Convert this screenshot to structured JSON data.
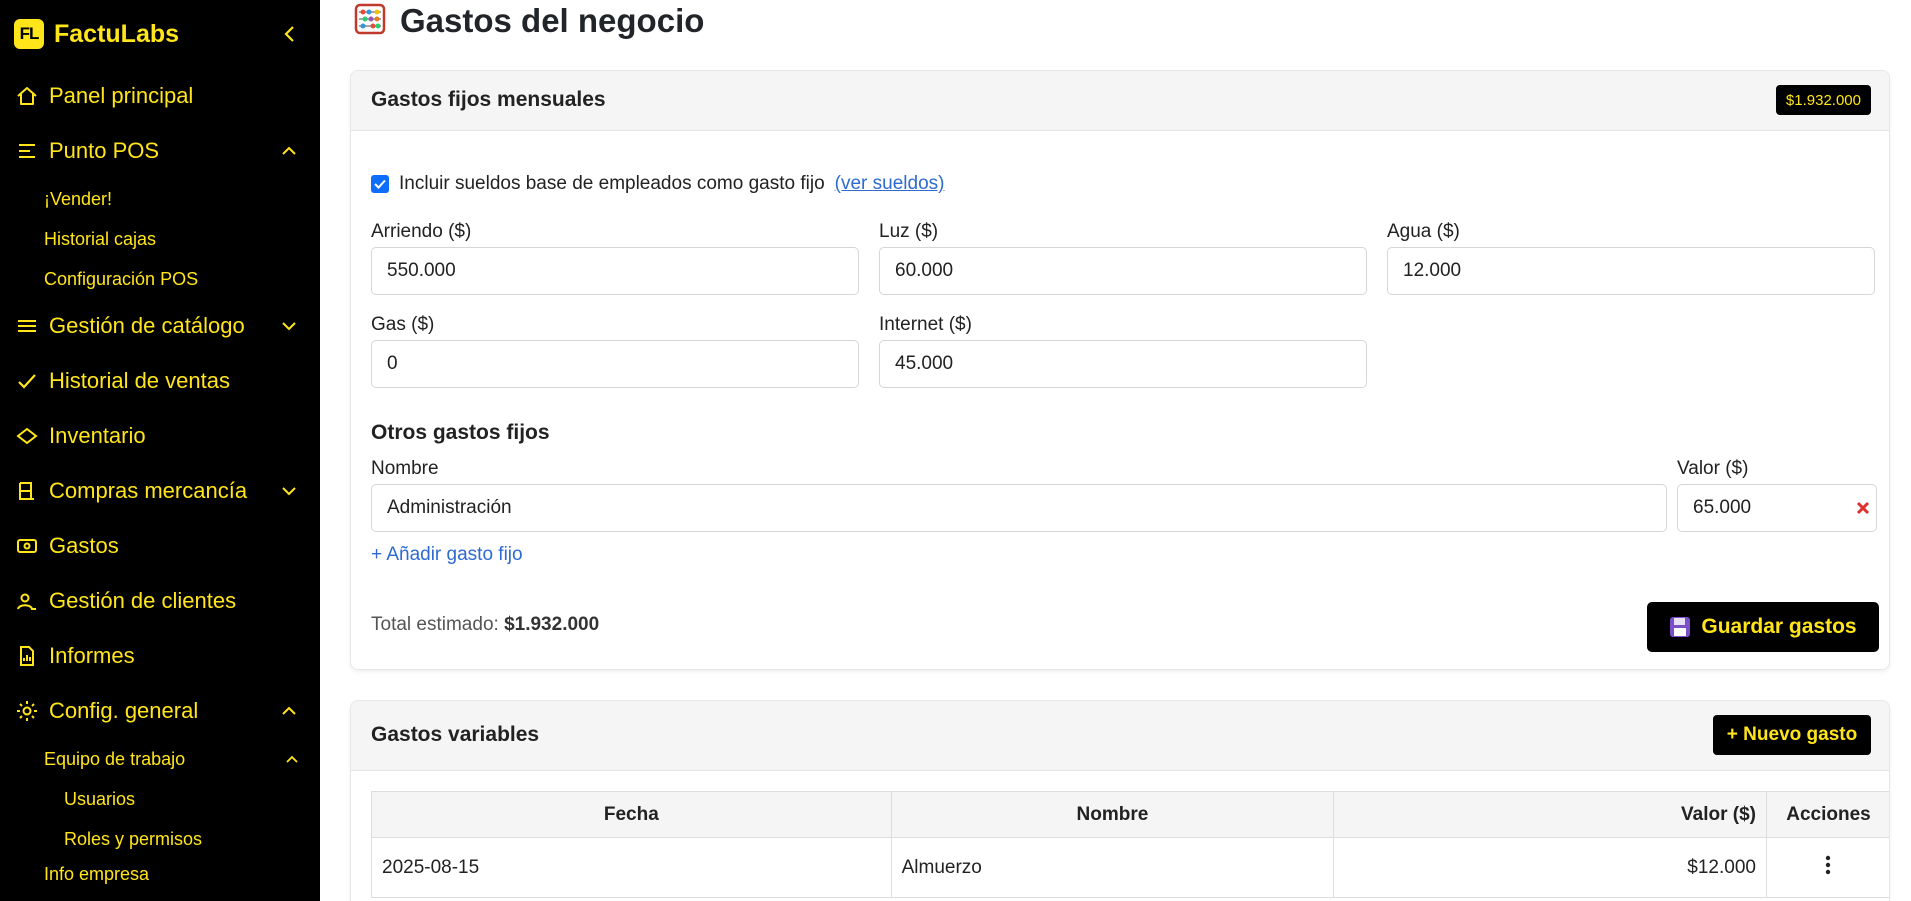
{
  "colors": {
    "accent": "#ffe51a",
    "sidebar_bg": "#000000",
    "link": "#2e6bd1",
    "checkbox": "#0d6efd",
    "remove": "#e03131"
  },
  "brand": {
    "logo_text": "FL",
    "name": "FactuLabs"
  },
  "sidebar": {
    "items": [
      {
        "label": "Panel principal",
        "icon": "home-icon"
      },
      {
        "label": "Punto POS",
        "icon": "pos-icon",
        "expanded": true
      },
      {
        "label": "Gestión de catálogo",
        "icon": "menu-icon",
        "expanded": false
      },
      {
        "label": "Historial de ventas",
        "icon": "check-icon"
      },
      {
        "label": "Inventario",
        "icon": "diamond-icon"
      },
      {
        "label": "Compras mercancía",
        "icon": "cart-icon",
        "expanded": false
      },
      {
        "label": "Gastos",
        "icon": "cash-icon"
      },
      {
        "label": "Gestión de clientes",
        "icon": "clients-icon"
      },
      {
        "label": "Informes",
        "icon": "report-icon"
      },
      {
        "label": "Config. general",
        "icon": "settings-icon",
        "expanded": true
      }
    ],
    "pos_sub": [
      "¡Vender!",
      "Historial cajas",
      "Configuración POS"
    ],
    "config_sub": {
      "team": "Equipo de trabajo",
      "team_sub": [
        "Usuarios",
        "Roles y permisos"
      ],
      "company": "Info empresa"
    }
  },
  "page": {
    "title": "Gastos del negocio",
    "icon": "abacus-icon"
  },
  "fixed": {
    "title": "Gastos fijos mensuales",
    "badge": "$1.932.000",
    "include_salaries": true,
    "include_label": "Incluir sueldos base de empleados como gasto fijo",
    "see_salaries": "(ver sueldos)",
    "fields": {
      "rent": {
        "label": "Arriendo ($)",
        "value": "550.000"
      },
      "power": {
        "label": "Luz ($)",
        "value": "60.000"
      },
      "water": {
        "label": "Agua ($)",
        "value": "12.000"
      },
      "gas": {
        "label": "Gas ($)",
        "value": "0"
      },
      "internet": {
        "label": "Internet ($)",
        "value": "45.000"
      }
    },
    "others_title": "Otros gastos fijos",
    "name_label": "Nombre",
    "value_label": "Valor ($)",
    "others": [
      {
        "name": "Administración",
        "value": "65.000"
      }
    ],
    "add_label": "+ Añadir gasto fijo",
    "total_label": "Total estimado:",
    "total_value": "$1.932.000",
    "save_label": "Guardar gastos",
    "save_icon": "floppy-disk-icon"
  },
  "variable": {
    "title": "Gastos variables",
    "new_label": "+ Nuevo gasto",
    "columns": [
      "Fecha",
      "Nombre",
      "Valor ($)",
      "Acciones"
    ],
    "rows": [
      {
        "date": "2025-08-15",
        "name": "Almuerzo",
        "value": "$12.000"
      }
    ]
  }
}
